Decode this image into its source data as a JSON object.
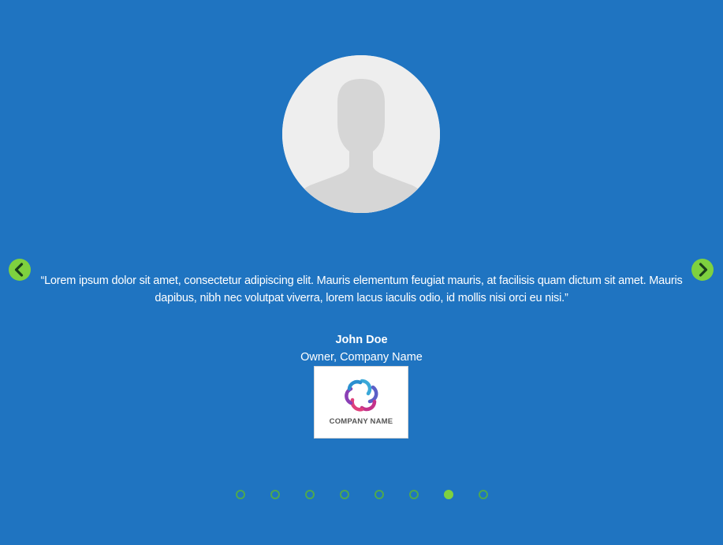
{
  "testimonial": {
    "quote": "“Lorem ipsum dolor sit amet, consectetur adipiscing elit. Mauris elementum feugiat mauris, at facilisis quam dictum sit amet. Mauris dapibus, nibh nec volutpat viverra, lorem lacus iaculis odio, id mollis nisi orci eu nisi.”",
    "author_name": "John Doe",
    "author_title": "Owner, Company Name",
    "company_logo_text": "COMPANY NAME"
  },
  "navigation": {
    "prev_icon": "chevron-left-icon",
    "next_icon": "chevron-right-icon"
  },
  "pagination": {
    "total": 8,
    "active_index": 6
  },
  "colors": {
    "background": "#1f74c1",
    "accent": "#7ed13f",
    "dot_border": "#4ea84f"
  }
}
